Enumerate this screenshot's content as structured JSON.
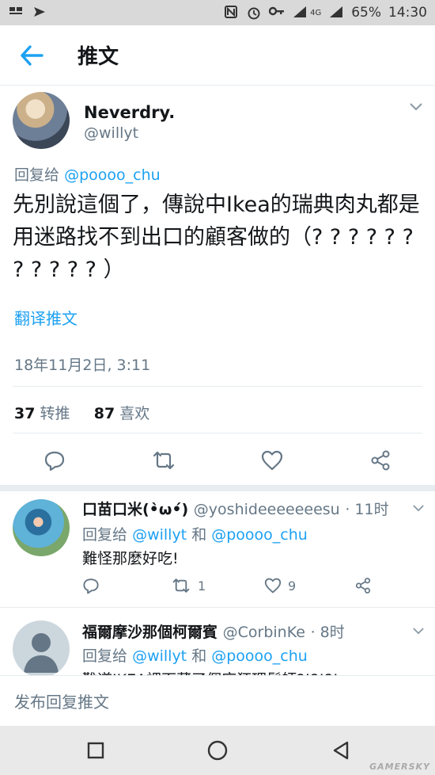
{
  "status_bar": {
    "battery": "65%",
    "time": "14:30",
    "network": "4G"
  },
  "header": {
    "title": "推文"
  },
  "tweet": {
    "author_name": "Neverdry.",
    "author_handle": "@willyt",
    "replying_label": "回复给",
    "replying_to": "@poooo_chu",
    "text": "先別說這個了，傳說中Ikea的瑞典肉丸都是用迷路找不到出口的顧客做的（? ? ? ? ? ? ? ? ? ? ? ）",
    "translate": "翻译推文",
    "timestamp": "18年11月2日, 3:11",
    "retweet_count": "37",
    "retweet_label": "转推",
    "like_count": "87",
    "like_label": "喜欢"
  },
  "replies": [
    {
      "name": "口苗口米(•̀ω•́)",
      "handle": "@yoshideeeeeeesu",
      "time": "· 11时",
      "replying_label": "回复给",
      "mention1": "@willyt",
      "and": "和",
      "mention2": "@poooo_chu",
      "text": "難怪那麼好吃!",
      "retweets": "1",
      "likes": "9"
    },
    {
      "name": "福爾摩沙那個柯爾賓",
      "handle": "@CorbinKe",
      "time": "· 8时",
      "replying_label": "回复给",
      "mention1": "@willyt",
      "and": "和",
      "mention2": "@poooo_chu",
      "text": "難道IKEA裡面藏了個麻狂理髮師?!?!?!"
    }
  ],
  "compose": {
    "placeholder": "发布回复推文"
  },
  "watermark": "GAMERSKY",
  "colors": {
    "accent": "#1da1f2",
    "secondary_text": "#657786",
    "primary_text": "#14171a"
  }
}
